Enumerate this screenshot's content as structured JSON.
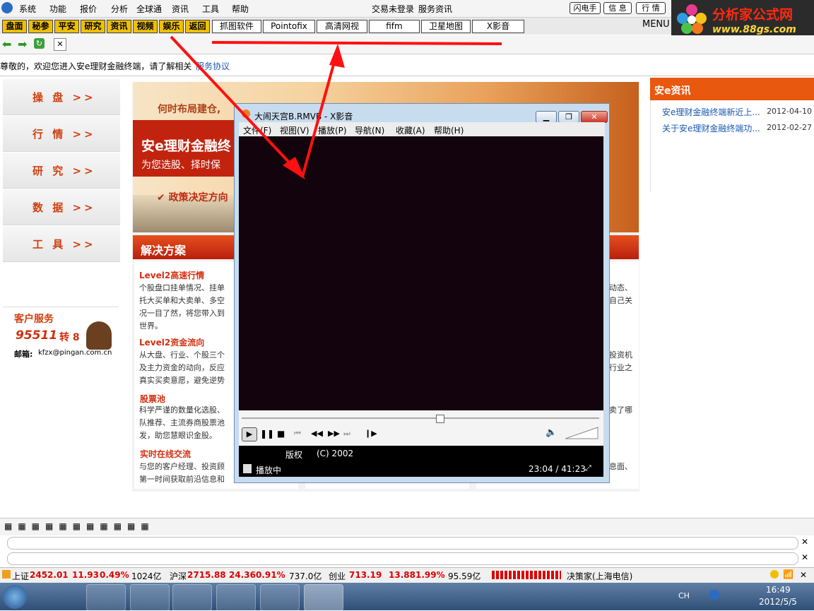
{
  "menubar": {
    "items": [
      "系统",
      "功能",
      "报价",
      "分析",
      "全球通",
      "资讯",
      "工具",
      "帮助"
    ],
    "status": "交易未登录",
    "service": "服务资讯",
    "right_buttons": [
      "闪电手",
      "信 息",
      "行 情"
    ]
  },
  "logo": {
    "name": "分析家公式网",
    "url": "www.88gs.com"
  },
  "toolbar2": {
    "yellow": [
      "盘面",
      "秘参",
      "平安",
      "研究",
      "资讯",
      "视频",
      "娱乐",
      "返回"
    ],
    "white": [
      "抓图软件",
      "Pointofix",
      "高清网视",
      "fifm",
      "卫星地图",
      "X影音"
    ],
    "menu_label": "MENU"
  },
  "welcome": {
    "text": "尊敬的，欢迎您进入安e理财金融终端，请了解相关",
    "link": "服务协议"
  },
  "sidebar": {
    "items": [
      "操 盘 >>",
      "行 情 >>",
      "研 究 >>",
      "数 据 >>",
      "工 具 >>"
    ],
    "service_title": "客户服务",
    "phone": "95511",
    "phone_ext": "转 8",
    "email_label": "邮箱:",
    "email": "kfzx@pingan.com.cn"
  },
  "banner": {
    "tagline": "何时布局建仓,",
    "title": "安e理财金融终",
    "subtitle": "为您选股、择时保",
    "policy": "✔ 政策决定方向"
  },
  "solutions": {
    "header": "解决方案",
    "features": [
      {
        "title": "Level2高速行情",
        "lines": [
          "个股盘口挂单情况、挂单",
          "托大买单和大卖单、多空",
          "况一目了然，将您带入到",
          "世界。"
        ]
      },
      {
        "title": "Level2资金流向",
        "lines": [
          "从大盘、行业、个股三个",
          "及主力资金的动向，反应",
          "真实买卖意愿，避免逆势"
        ]
      },
      {
        "title": "股票池",
        "lines": [
          "科学严谨的数量化选股、",
          "队推荐、主流券商股票池",
          "发，助您慧眼识金股。"
        ]
      },
      {
        "title": "实时在线交流",
        "lines": [
          "与您的客户经理、投资顾",
          "第一时间获取前沿信息和"
        ]
      }
    ],
    "right_snippets": [
      "动态、",
      "自己关",
      "投资机",
      "行业之",
      "卖了哪",
      "息面、"
    ]
  },
  "right_panel": {
    "title": "安e资讯",
    "news": [
      {
        "title": "安e理财金融终端新近上...",
        "date": "2012-04-10"
      },
      {
        "title": "关于安e理财金融终端功...",
        "date": "2012-02-27"
      }
    ]
  },
  "player": {
    "title": "大闹天宫B.RMVB - X影音",
    "menu": [
      "文件(F)",
      "视图(V)",
      "播放(P)",
      "导航(N)",
      "收藏(A)",
      "帮助(H)"
    ],
    "info_label": "版权",
    "info_value": "(C) 2002",
    "status": "播放中",
    "time": "23:04 / 41:23",
    "progress": 0.55
  },
  "ticker": {
    "sh_label": "上证",
    "sh_value": "2452.01",
    "sh_change": "11.93",
    "sh_pct": "0.49%",
    "sh_vol": "1024亿",
    "sz_label": "沪深",
    "sz_value": "2715.88",
    "sz_change": "24.36",
    "sz_pct": "0.91%",
    "sz_vol": "737.0亿",
    "cy_label": "创业",
    "cy_value": "713.19",
    "cy_change": "13.88",
    "cy_pct": "1.99%",
    "cy_vol": "95.59亿",
    "server": "决策家(上海电信)"
  },
  "taskbar": {
    "lang": "CH",
    "time": "16:49",
    "date": "2012/5/5"
  }
}
